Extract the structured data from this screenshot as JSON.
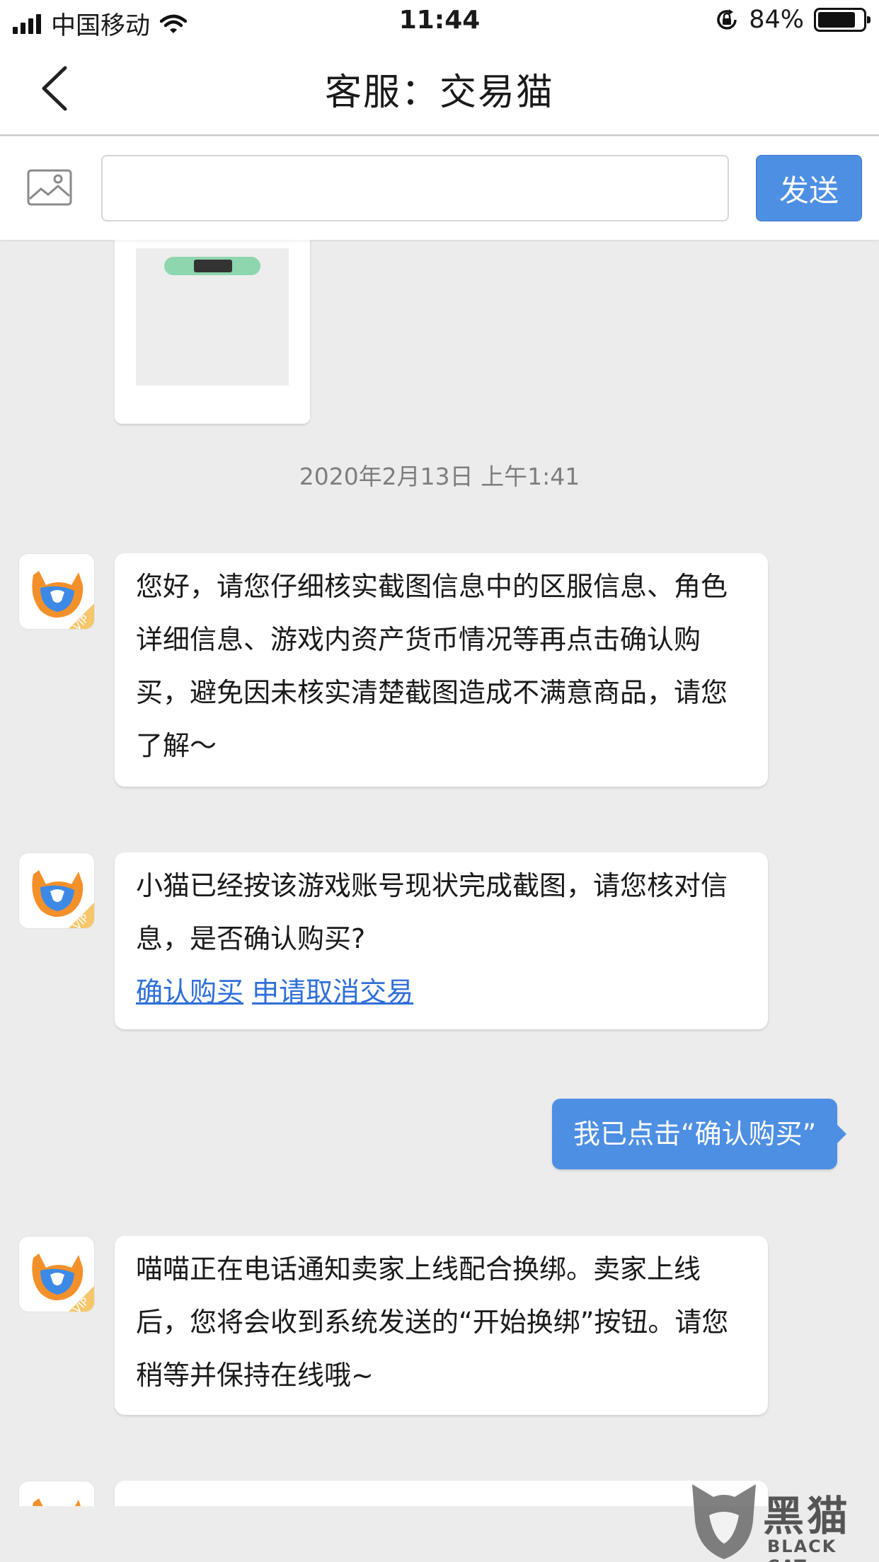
{
  "status_bar": {
    "carrier": "中国移动",
    "time": "11:44",
    "battery_percent_text": "84%",
    "battery_level": 0.84
  },
  "nav": {
    "back_icon": "chevron-left-icon",
    "title": "客服：交易猫"
  },
  "composer": {
    "image_icon": "image-icon",
    "input_value": "",
    "send_label": "发送"
  },
  "messages": {
    "timestamp": "2020年2月13日 上午1:41",
    "m1": {
      "sender": "agent",
      "text": "您好，请您仔细核实截图信息中的区服信息、角色详细信息、游戏内资产货币情况等再点击确认购买，避免因未核实清楚截图造成不满意商品，请您了解～"
    },
    "m2": {
      "sender": "agent",
      "text": "小猫已经按该游戏账号现状完成截图，请您核对信息，是否确认购买?",
      "link_confirm": "确认购买",
      "link_cancel": "申请取消交易"
    },
    "m3": {
      "sender": "me",
      "text": "我已点击“确认购买”"
    },
    "m4": {
      "sender": "agent",
      "text": "喵喵正在电话通知卖家上线配合换绑。卖家上线后，您将会收到系统发送的“开始换绑”按钮。请您稍等并保持在线哦~"
    }
  },
  "avatar_badge": "VIP",
  "watermark": {
    "title": "黑猫",
    "subtitle": "BLACK CAT"
  },
  "colors": {
    "accent_blue": "#4d8fe3",
    "link_blue": "#2f6fd8",
    "background": "#ececec"
  }
}
